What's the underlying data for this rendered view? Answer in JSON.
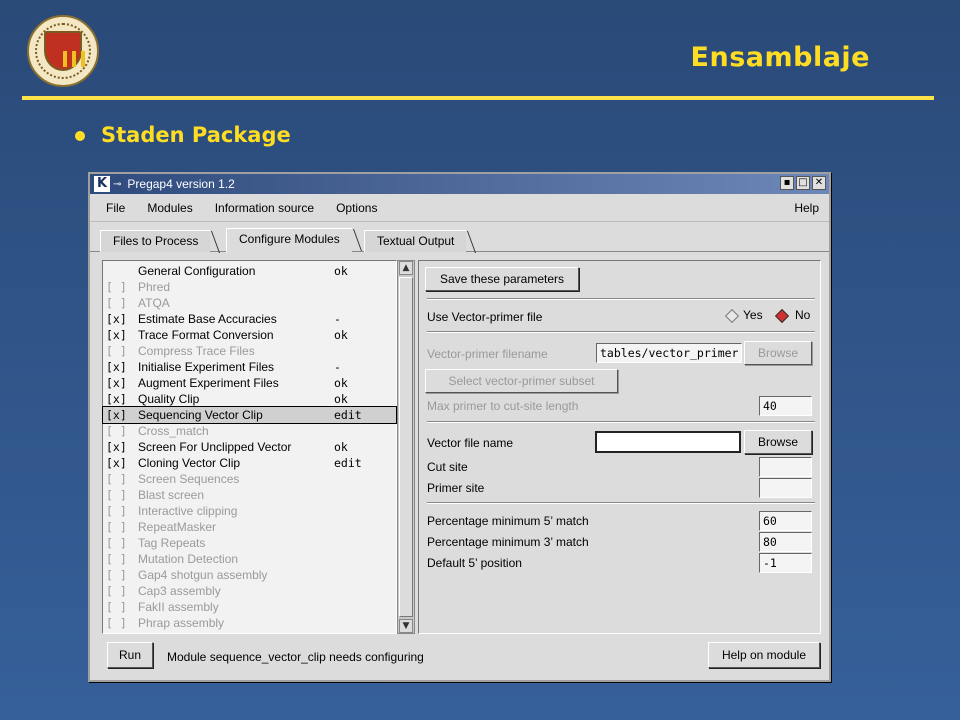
{
  "slide": {
    "title": "Ensamblaje",
    "bullet": "Staden Package"
  },
  "window": {
    "title": "Pregap4 version 1.2",
    "buttons": [
      "▪",
      "□",
      "✕"
    ]
  },
  "menu": {
    "file": "File",
    "modules": "Modules",
    "information_source": "Information source",
    "options": "Options",
    "help": "Help"
  },
  "tabs": [
    "Files to Process",
    "Configure Modules",
    "Textual Output"
  ],
  "modules": [
    {
      "check": "",
      "name": "General Configuration",
      "status": "ok",
      "enabled": true
    },
    {
      "check": "[ ]",
      "name": "Phred",
      "status": "",
      "enabled": false
    },
    {
      "check": "[ ]",
      "name": "ATQA",
      "status": "",
      "enabled": false
    },
    {
      "check": "[x]",
      "name": "Estimate Base Accuracies",
      "status": "-",
      "enabled": true
    },
    {
      "check": "[x]",
      "name": "Trace Format Conversion",
      "status": "ok",
      "enabled": true
    },
    {
      "check": "[ ]",
      "name": "Compress Trace Files",
      "status": "",
      "enabled": false
    },
    {
      "check": "[x]",
      "name": "Initialise Experiment Files",
      "status": "-",
      "enabled": true
    },
    {
      "check": "[x]",
      "name": "Augment Experiment Files",
      "status": "ok",
      "enabled": true
    },
    {
      "check": "[x]",
      "name": "Quality Clip",
      "status": "ok",
      "enabled": true
    },
    {
      "check": "[x]",
      "name": "Sequencing Vector Clip",
      "status": "edit",
      "enabled": true,
      "selected": true
    },
    {
      "check": "[ ]",
      "name": "Cross_match",
      "status": "",
      "enabled": false
    },
    {
      "check": "[x]",
      "name": "Screen For Unclipped Vector",
      "status": "ok",
      "enabled": true
    },
    {
      "check": "[x]",
      "name": "Cloning Vector Clip",
      "status": "edit",
      "enabled": true
    },
    {
      "check": "[ ]",
      "name": "Screen Sequences",
      "status": "",
      "enabled": false
    },
    {
      "check": "[ ]",
      "name": "Blast screen",
      "status": "",
      "enabled": false
    },
    {
      "check": "[ ]",
      "name": "Interactive clipping",
      "status": "",
      "enabled": false
    },
    {
      "check": "[ ]",
      "name": "RepeatMasker",
      "status": "",
      "enabled": false
    },
    {
      "check": "[ ]",
      "name": "Tag Repeats",
      "status": "",
      "enabled": false
    },
    {
      "check": "[ ]",
      "name": "Mutation Detection",
      "status": "",
      "enabled": false
    },
    {
      "check": "[ ]",
      "name": "Gap4 shotgun assembly",
      "status": "",
      "enabled": false
    },
    {
      "check": "[ ]",
      "name": "Cap3 assembly",
      "status": "",
      "enabled": false
    },
    {
      "check": "[ ]",
      "name": "FakII assembly",
      "status": "",
      "enabled": false
    },
    {
      "check": "[ ]",
      "name": "Phrap assembly",
      "status": "",
      "enabled": false
    }
  ],
  "config": {
    "save_button": "Save these parameters",
    "use_vector_primer_label": "Use Vector-primer file",
    "yes_label": "Yes",
    "no_label": "No",
    "vector_primer_filename_label": "Vector-primer filename",
    "vector_primer_filename_value": "tables/vector_primer",
    "browse_label": "Browse",
    "select_subset_button": "Select vector-primer subset",
    "max_primer_label": "Max primer to cut-site length",
    "max_primer_value": "40",
    "vector_file_label": "Vector file name",
    "vector_file_value": "",
    "cut_site_label": "Cut site",
    "cut_site_value": "",
    "primer_site_label": "Primer site",
    "primer_site_value": "",
    "pct_min5_label": "Percentage minimum 5’ match",
    "pct_min5_value": "60",
    "pct_min3_label": "Percentage minimum 3’ match",
    "pct_min3_value": "80",
    "default5_label": "Default 5’ position",
    "default5_value": "-1"
  },
  "footer": {
    "run_button": "Run",
    "status": "Module sequence_vector_clip needs configuring",
    "help_button": "Help on module"
  }
}
